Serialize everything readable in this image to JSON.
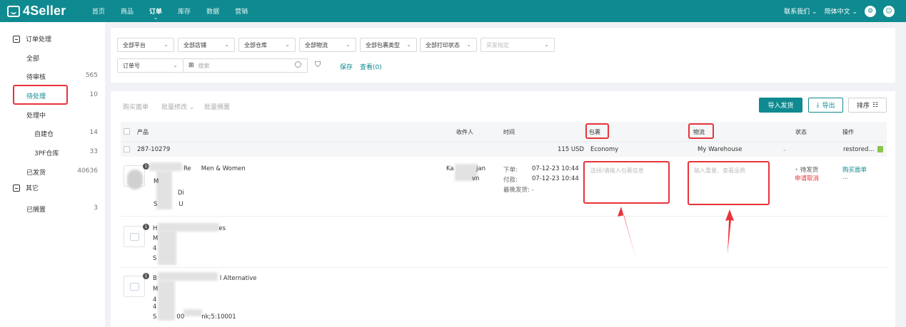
{
  "app": {
    "name": "4Seller"
  },
  "nav": {
    "items": [
      "首页",
      "商品",
      "订单",
      "库存",
      "数据",
      "营销"
    ],
    "active_index": 2,
    "right": {
      "contact": "联系我们",
      "language": "简体中文"
    }
  },
  "sidebar": {
    "group1": "订单处理",
    "items": [
      {
        "label": "全部",
        "count": ""
      },
      {
        "label": "待审核",
        "count": "565"
      },
      {
        "label": "待处理",
        "count": "10"
      },
      {
        "label": "处理中",
        "count": ""
      },
      {
        "label": "自建仓",
        "count": "14"
      },
      {
        "label": "3PF仓库",
        "count": "33"
      },
      {
        "label": "已发货",
        "count": "40636"
      }
    ],
    "group2": "其它",
    "items2": [
      {
        "label": "已搁置",
        "count": "3"
      }
    ]
  },
  "filters": {
    "selects": [
      "全部平台",
      "全部店铺",
      "全部仓库",
      "全部物流",
      "全部包裹类型",
      "全部打印状态"
    ],
    "buyer_placeholder": "买家指定",
    "search_type": "订单号",
    "search_placeholder": "搜索",
    "save": "保存",
    "view": "查看(0)"
  },
  "toolbar": {
    "buy_label": "购买面单",
    "batch_edit": "批量修改",
    "batch_hold": "批量搁置",
    "import_ship": "导入发货",
    "export": "导出",
    "sort": "排序"
  },
  "table": {
    "headers": {
      "product": "产品",
      "receiver": "收件人",
      "time": "时间",
      "package": "包裹",
      "logistics": "物流",
      "status": "状态",
      "action": "操作"
    },
    "group": {
      "order_no": "287-10279",
      "amount": "115 USD",
      "package": "Economy",
      "warehouse": "My Warehouse",
      "store": "restored..."
    },
    "orders": [
      {
        "badge": "1",
        "title_a": "Re",
        "title_b": "Men & Women",
        "l1": "M",
        "l2a": "",
        "l2b": "Di",
        "l3": "S",
        "l3b": "U",
        "receiver_a": "Ka",
        "receiver_b": "jan",
        "receiver_c": "vn",
        "order_label": "下单:",
        "order_time": "07-12-23 10:44",
        "pay_label": "付款:",
        "pay_time": "07-12-23 10:44",
        "ship_label": "最晚发货: -",
        "package_placeholder": "选择/请输入包裹信息",
        "logistics_placeholder": "输入重量、查看运费",
        "status": "待发货",
        "status_sub": "申请取消",
        "action": "购买面单",
        "action_more": "..."
      },
      {
        "badge": "1",
        "title_a": "H",
        "title_b": "es",
        "l1": "M",
        "l2": "4",
        "l3": "S"
      },
      {
        "badge": "1",
        "title_a": "B",
        "title_b": "l Alternative",
        "l1": "M",
        "l2": "4",
        "l3": "4",
        "l4a": "S",
        "l4b": "00",
        "l4c": "nk;5:10001"
      }
    ]
  },
  "colors": {
    "brand": "#0f8a90",
    "annotation": "#e8333a"
  }
}
